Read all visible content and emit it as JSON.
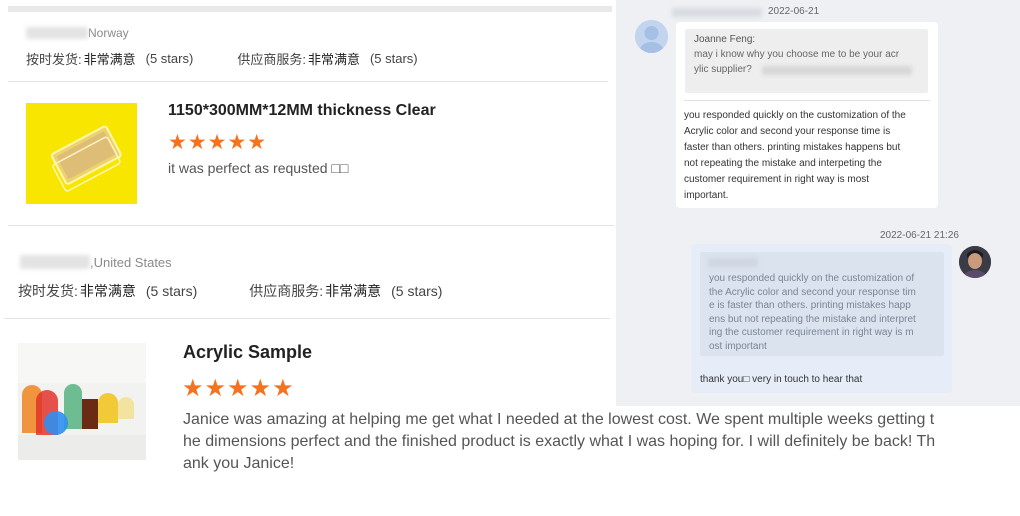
{
  "reviews": [
    {
      "country": "Norway",
      "shipping_label": "按时发货:",
      "shipping_value": "非常满意",
      "shipping_stars": "(5 stars)",
      "service_label": "供应商服务:",
      "service_value": "非常满意",
      "service_stars": "(5 stars)",
      "product_title": "1150*300MM*12MM thickness Clear",
      "stars": "★★★★★",
      "rating": 5,
      "text": "it was perfect as requsted □□"
    },
    {
      "country": ",United States",
      "shipping_label": "按时发货:",
      "shipping_value": "非常满意",
      "shipping_stars": "(5 stars)",
      "service_label": "供应商服务:",
      "service_value": "非常满意",
      "service_stars": "(5 stars)",
      "product_title": "Acrylic Sample",
      "stars": "★★★★★",
      "rating": 5,
      "text_line1": "Janice was amazing at helping me get what I needed at the lowest cost. We spent multiple weeks getting t",
      "text_line2": "he dimensions perfect and the finished product is exactly what I was hoping for. I will definitely be back! Th",
      "text_line3": "ank you Janice!"
    }
  ],
  "chat": {
    "msg1_time": "2022-06-21",
    "quote_name": "Joanne Feng:",
    "quote_line1": "may i know why you choose me to be your acr",
    "quote_line2": "ylic supplier?",
    "msg1_lines": [
      "you responded quickly on the customization of the",
      "Acrylic color and second your response time is",
      "faster than others. printing mistakes happens but",
      "not repeating the mistake and interpeting the",
      "customer requirement in right way is most",
      "important."
    ],
    "msg2_time": "2022-06-21 21:26",
    "msg2_quote_lines": [
      "you responded quickly on the customization of",
      "the Acrylic color and second your response tim",
      "e is faster than others. printing mistakes happ",
      "ens but not repeating the mistake and interpret",
      "ing the customer requirement in right way is m",
      "ost important"
    ],
    "msg2_reply": "thank you□ very in touch to hear that"
  },
  "colors": {
    "star": "#f5731e",
    "chat_bg": "#eef0f3",
    "sent_bubble": "#e6edf8"
  }
}
